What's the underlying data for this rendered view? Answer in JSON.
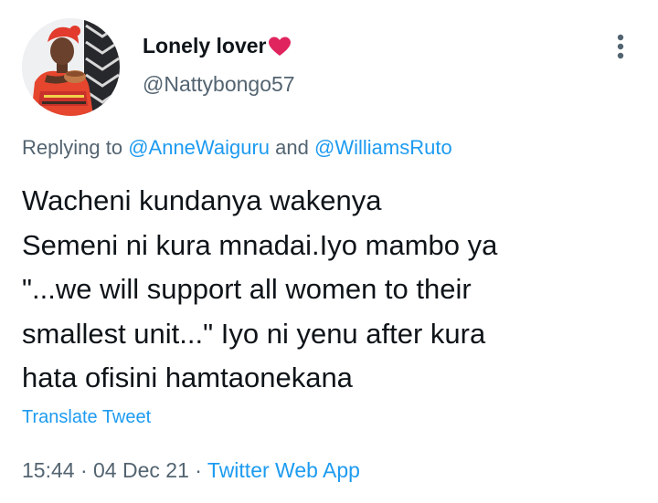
{
  "author": {
    "display_name": "Lonely lover",
    "name_symbol": "",
    "heart_icon": "red-heart-icon",
    "handle": "@Nattybongo57"
  },
  "reply": {
    "prefix": "Replying to",
    "mention_1": "@AnneWaiguru",
    "conjunction": "and",
    "mention_2": "@WilliamsRuto"
  },
  "tweet": {
    "lines": [
      "Wacheni kundanya wakenya",
      "Semeni ni kura mnadai.Iyo mambo ya",
      "\"...we will support all women to their",
      "smallest unit...\" Iyo ni yenu after kura",
      "hata ofisini hamtaonekana"
    ]
  },
  "translate_label": "Translate Tweet",
  "meta": {
    "time": "15:44",
    "separator": "·",
    "date": "04 Dec 21",
    "app": "Twitter Web App"
  },
  "colors": {
    "link": "#1d9bf0",
    "secondary_text": "#536471",
    "primary_text": "#0f1419",
    "heart": "#e0245e"
  }
}
